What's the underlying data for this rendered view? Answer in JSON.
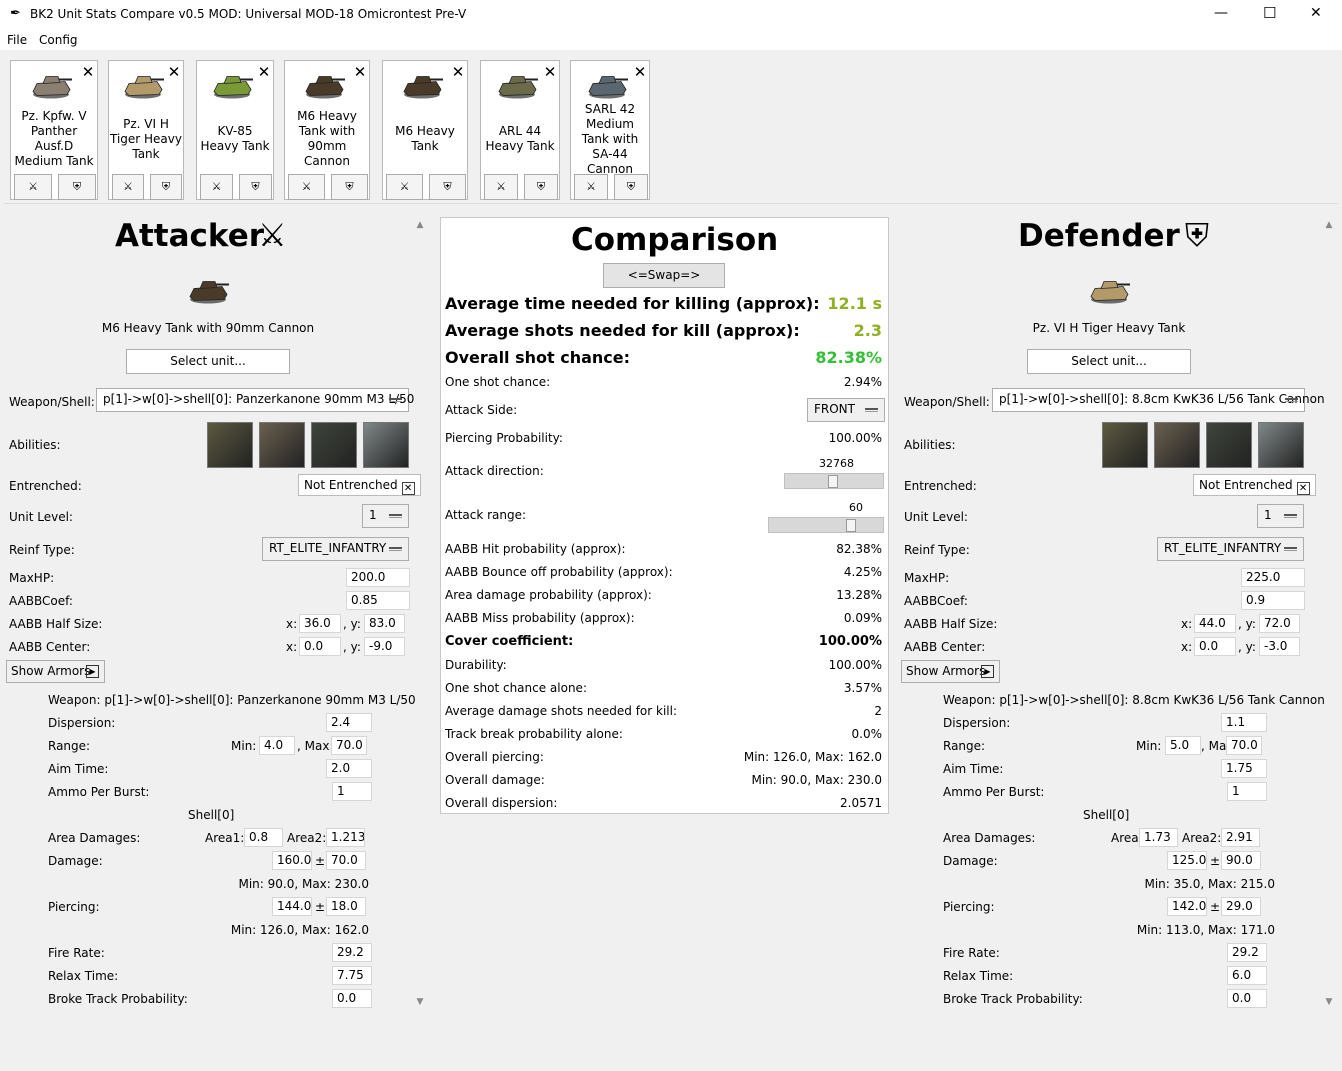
{
  "window": {
    "title": "BK2 Unit Stats Compare v0.5 MOD: Universal MOD-18 Omicrontest Pre-V",
    "minimize": "—",
    "maximize": "☐",
    "close": "✕"
  },
  "menu": {
    "file": "File",
    "config": "Config"
  },
  "units": [
    {
      "name": "Pz. Kpfw. V Panther Ausf.D Medium Tank",
      "color": "#8a7f70"
    },
    {
      "name": "Pz. VI H Tiger Heavy Tank",
      "color": "#b39a6a"
    },
    {
      "name": "KV-85 Heavy Tank",
      "color": "#7a9a38"
    },
    {
      "name": "M6 Heavy Tank with 90mm Cannon",
      "color": "#4a3a2a"
    },
    {
      "name": "M6 Heavy Tank",
      "color": "#4a3a2a"
    },
    {
      "name": "ARL 44 Heavy Tank",
      "color": "#6b6a4a"
    },
    {
      "name": "SARL 42 Medium Tank with SA-44 Cannon",
      "color": "#5a6670"
    }
  ],
  "icons": {
    "close": "✕",
    "attack": "⚔",
    "defend": "⛨"
  },
  "attacker": {
    "title": "Attacker",
    "unit_name": "M6 Heavy Tank with 90mm Cannon",
    "select_label": "Select unit...",
    "weapon_label": "Weapon/Shell:",
    "weapon_value": "p[1]->w[0]->shell[0]: Panzerkanone 90mm M3 L/50",
    "abilities_label": "Abilities:",
    "entrenched_label": "Entrenched:",
    "entrenched_value": "Not Entrenched",
    "level_label": "Unit Level:",
    "level_value": "1",
    "reinf_label": "Reinf Type:",
    "reinf_value": "RT_ELITE_INFANTRY",
    "maxhp_label": "MaxHP:",
    "maxhp": "200.0",
    "aabbcoef_label": "AABBCoef:",
    "aabbcoef": "0.85",
    "halfsize_label": "AABB Half Size:",
    "halfsize_x": "36.0",
    "halfsize_y": "83.0",
    "center_label": "AABB Center:",
    "center_x": "0.0",
    "center_y": "-9.0",
    "x_label": "x:",
    "y_label": ", y:",
    "show_armors": "Show Armors",
    "weapon_line": "Weapon: p[1]->w[0]->shell[0]: Panzerkanone 90mm M3 L/50",
    "dispersion_label": "Dispersion:",
    "dispersion": "2.4",
    "range_label": "Range:",
    "min_label": "Min:",
    "max_label": ", Max:",
    "range_min": "4.0",
    "range_max": "70.0",
    "aim_label": "Aim Time:",
    "aim": "2.0",
    "ammo_label": "Ammo Per Burst:",
    "ammo": "1",
    "shell_label": "Shell[0]",
    "area_label": "Area Damages:",
    "area1_label": "Area1:",
    "area1": "0.8",
    "area2_label": "Area2:",
    "area2": "1.213",
    "damage_label": "Damage:",
    "damage": "160.0",
    "damage_pm": "70.0",
    "pm": "±",
    "damage_range": "Min: 90.0, Max: 230.0",
    "piercing_label": "Piercing:",
    "piercing": "144.0",
    "piercing_pm": "18.0",
    "piercing_range": "Min: 126.0, Max: 162.0",
    "firerate_label": "Fire Rate:",
    "firerate": "29.2",
    "relax_label": "Relax Time:",
    "relax": "7.75",
    "track_label": "Broke Track Probability:",
    "track": "0.0"
  },
  "defender": {
    "title": "Defender",
    "unit_name": "Pz. VI H Tiger Heavy Tank",
    "select_label": "Select unit...",
    "weapon_label": "Weapon/Shell:",
    "weapon_value": "p[1]->w[0]->shell[0]: 8.8cm KwK36 L/56 Tank Cannon",
    "abilities_label": "Abilities:",
    "entrenched_label": "Entrenched:",
    "entrenched_value": "Not Entrenched",
    "level_label": "Unit Level:",
    "level_value": "1",
    "reinf_label": "Reinf Type:",
    "reinf_value": "RT_ELITE_INFANTRY",
    "maxhp_label": "MaxHP:",
    "maxhp": "225.0",
    "aabbcoef_label": "AABBCoef:",
    "aabbcoef": "0.9",
    "halfsize_label": "AABB Half Size:",
    "halfsize_x": "44.0",
    "halfsize_y": "72.0",
    "center_label": "AABB Center:",
    "center_x": "0.0",
    "center_y": "-3.0",
    "x_label": "x:",
    "y_label": ", y:",
    "show_armors": "Show Armors",
    "weapon_line": "Weapon: p[1]->w[0]->shell[0]: 8.8cm KwK36 L/56 Tank Cannon",
    "dispersion_label": "Dispersion:",
    "dispersion": "1.1",
    "range_label": "Range:",
    "min_label": "Min:",
    "max_label": ", Max:",
    "range_min": "5.0",
    "range_max": "70.0",
    "aim_label": "Aim Time:",
    "aim": "1.75",
    "ammo_label": "Ammo Per Burst:",
    "ammo": "1",
    "shell_label": "Shell[0]",
    "area_label": "Area Damages:",
    "area1_label": "Area1:",
    "area1": "1.73",
    "area2_label": "Area2:",
    "area2": "2.91",
    "damage_label": "Damage:",
    "damage": "125.0",
    "damage_pm": "90.0",
    "pm": "±",
    "damage_range": "Min: 35.0, Max: 215.0",
    "piercing_label": "Piercing:",
    "piercing": "142.0",
    "piercing_pm": "29.0",
    "piercing_range": "Min: 113.0, Max: 171.0",
    "firerate_label": "Fire Rate:",
    "firerate": "29.2",
    "relax_label": "Relax Time:",
    "relax": "6.0",
    "track_label": "Broke Track Probability:",
    "track": "0.0"
  },
  "comparison": {
    "title": "Comparison",
    "swap": "<=Swap=>",
    "time_label": "Average time needed for killing (approx):",
    "time": "12.1 s",
    "shots_label": "Average shots needed for kill (approx):",
    "shots": "2.3",
    "shot_chance_label": "Overall shot chance:",
    "shot_chance": "82.38%",
    "one_shot_label": "One shot chance:",
    "one_shot": "2.94%",
    "side_label": "Attack Side:",
    "side": "FRONT",
    "pierce_prob_label": "Piercing Probability:",
    "pierce_prob": "100.00%",
    "direction_label": "Attack direction:",
    "direction": "32768",
    "direction_frac": 0.5,
    "range_label": "Attack range:",
    "range": "60",
    "range_frac": 0.75,
    "hit_label": "AABB Hit probability (approx):",
    "hit": "82.38%",
    "bounce_label": "AABB Bounce off probability (approx):",
    "bounce": "4.25%",
    "area_label": "Area damage probability (approx):",
    "area": "13.28%",
    "miss_label": "AABB Miss probability (approx):",
    "miss": "0.09%",
    "cover_label": "Cover coefficient:",
    "cover": "100.00%",
    "durability_label": "Durability:",
    "durability": "100.00%",
    "alone_label": "One shot chance alone:",
    "alone": "3.57%",
    "avg_dmg_label": "Average damage shots needed for kill:",
    "avg_dmg": "2",
    "track_label": "Track break probability alone:",
    "track": "0.0%",
    "o_pierce_label": "Overall piercing:",
    "o_pierce": "Min: 126.0, Max: 162.0",
    "o_damage_label": "Overall damage:",
    "o_damage": "Min: 90.0, Max: 230.0",
    "o_disp_label": "Overall dispersion:",
    "o_disp": "2.0571",
    "colors": {
      "time": "#8fb020",
      "shots": "#8fb020",
      "chance": "#34c034"
    }
  }
}
